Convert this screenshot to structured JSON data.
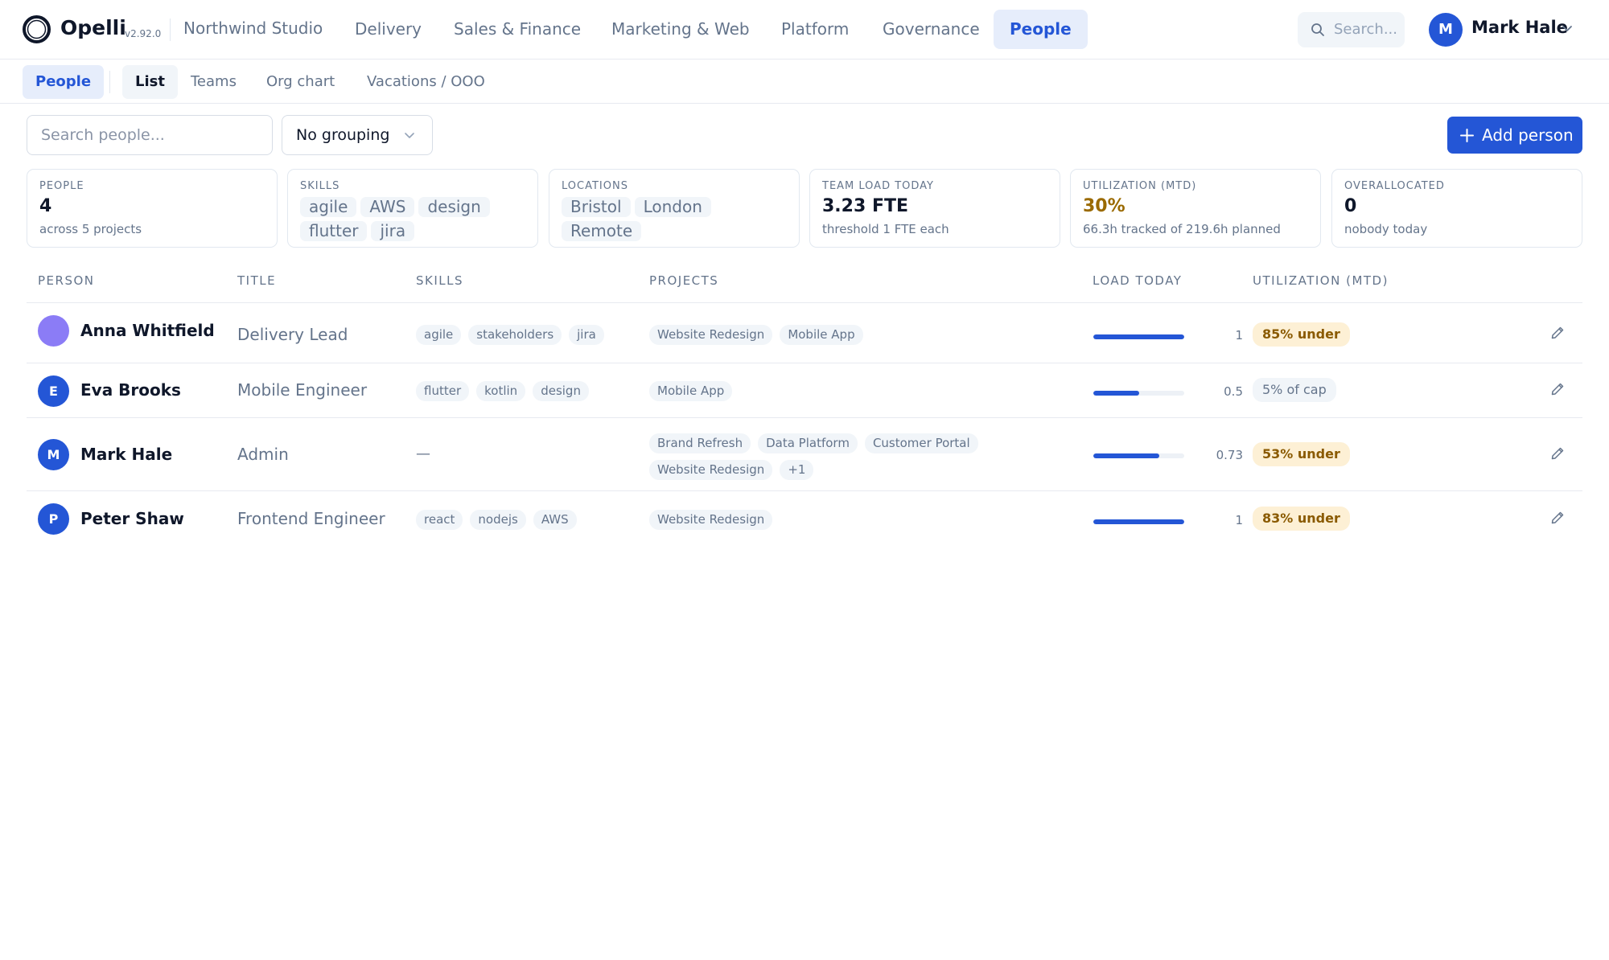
{
  "app": {
    "name": "Opelli",
    "version": "v2.92.0",
    "workspace": "Northwind Studio"
  },
  "nav": {
    "items": [
      "Delivery",
      "Sales & Finance",
      "Marketing & Web",
      "Platform",
      "Governance",
      "People"
    ],
    "active": "People"
  },
  "global_search": {
    "placeholder": "Search..."
  },
  "user": {
    "initial": "M",
    "name": "Mark Hale"
  },
  "subnav": {
    "section": "People",
    "tabs": [
      "List",
      "Teams",
      "Org chart",
      "Vacations / OOO"
    ],
    "active": "List"
  },
  "toolbar": {
    "search_placeholder": "Search people...",
    "grouping": "No grouping",
    "add_label": "Add person"
  },
  "stats": {
    "people": {
      "label": "PEOPLE",
      "value": "4",
      "sub": "across 5 projects"
    },
    "skills": {
      "label": "SKILLS",
      "chips": [
        "agile",
        "AWS",
        "design",
        "flutter",
        "jira"
      ]
    },
    "locations": {
      "label": "LOCATIONS",
      "chips": [
        "Bristol",
        "London",
        "Remote"
      ]
    },
    "team_load": {
      "label": "TEAM LOAD TODAY",
      "value": "3.23 FTE",
      "sub": "threshold 1 FTE each"
    },
    "utilization": {
      "label": "UTILIZATION (MTD)",
      "value": "30%",
      "sub": "66.3h tracked of 219.6h planned"
    },
    "overallocated": {
      "label": "OVERALLOCATED",
      "value": "0",
      "sub": "nobody today"
    }
  },
  "table": {
    "headers": [
      "PERSON",
      "TITLE",
      "SKILLS",
      "PROJECTS",
      "LOAD TODAY",
      "UTILIZATION (MTD)"
    ],
    "rows": [
      {
        "initial": "",
        "name": "Anna Whitfield",
        "title": "Delivery Lead",
        "skills": [
          "agile",
          "stakeholders",
          "jira"
        ],
        "projects": [
          "Website Redesign",
          "Mobile App"
        ],
        "load": "1",
        "load_fraction": 1,
        "utilization": "85% under",
        "util_kind": "under",
        "avatar_color": "#8b7cf6"
      },
      {
        "initial": "E",
        "name": "Eva Brooks",
        "title": "Mobile Engineer",
        "skills": [
          "flutter",
          "kotlin",
          "design"
        ],
        "projects": [
          "Mobile App"
        ],
        "load": "0.5",
        "load_fraction": 0.5,
        "utilization": "5% of cap",
        "util_kind": "cap",
        "avatar_color": "#2456d6"
      },
      {
        "initial": "M",
        "name": "Mark Hale",
        "title": "Admin",
        "skills": [],
        "skills_empty": "—",
        "projects": [
          "Brand Refresh",
          "Data Platform",
          "Customer Portal",
          "Website Redesign",
          "+1"
        ],
        "load": "0.73",
        "load_fraction": 0.73,
        "utilization": "53% under",
        "util_kind": "under",
        "avatar_color": "#2456d6"
      },
      {
        "initial": "P",
        "name": "Peter Shaw",
        "title": "Frontend Engineer",
        "skills": [
          "react",
          "nodejs",
          "AWS"
        ],
        "projects": [
          "Website Redesign"
        ],
        "load": "1",
        "load_fraction": 1,
        "utilization": "83% under",
        "util_kind": "under",
        "avatar_color": "#2456d6"
      }
    ]
  },
  "colors": {
    "accent": "#2456d6",
    "accent_soft": "#e6edfb",
    "warning_bg": "#fdf0d5",
    "warning_text": "#8a5a00"
  }
}
